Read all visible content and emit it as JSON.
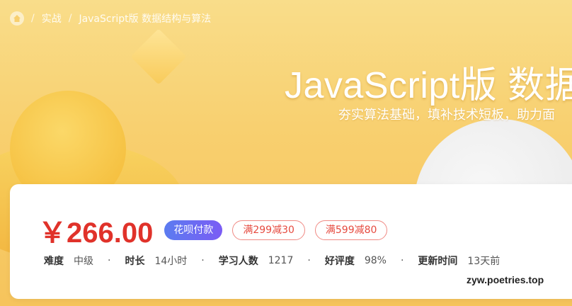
{
  "breadcrumb": {
    "items": [
      "实战",
      "JavaScript版 数据结构与算法"
    ]
  },
  "hero": {
    "title": "JavaScript版 数据结",
    "subtitle": "夯实算法基础，填补技术短板，助力面"
  },
  "price": {
    "value": "￥266.00",
    "huabei_badge": "花呗付款",
    "coupons": [
      "满299减30",
      "满599减80"
    ]
  },
  "meta": {
    "difficulty_label": "难度",
    "difficulty_value": "中级",
    "duration_label": "时长",
    "duration_value": "14小时",
    "learners_label": "学习人数",
    "learners_value": "1217",
    "rating_label": "好评度",
    "rating_value": "98%",
    "updated_label": "更新时间",
    "updated_value": "13天前"
  },
  "watermark": "zyw.poetries.top",
  "colors": {
    "price": "#e0322a",
    "hero_bg": "#f8cf6e",
    "badge_gradient_start": "#5b7cf0",
    "badge_gradient_end": "#7b5cf4",
    "coupon_border": "#f08a84"
  }
}
